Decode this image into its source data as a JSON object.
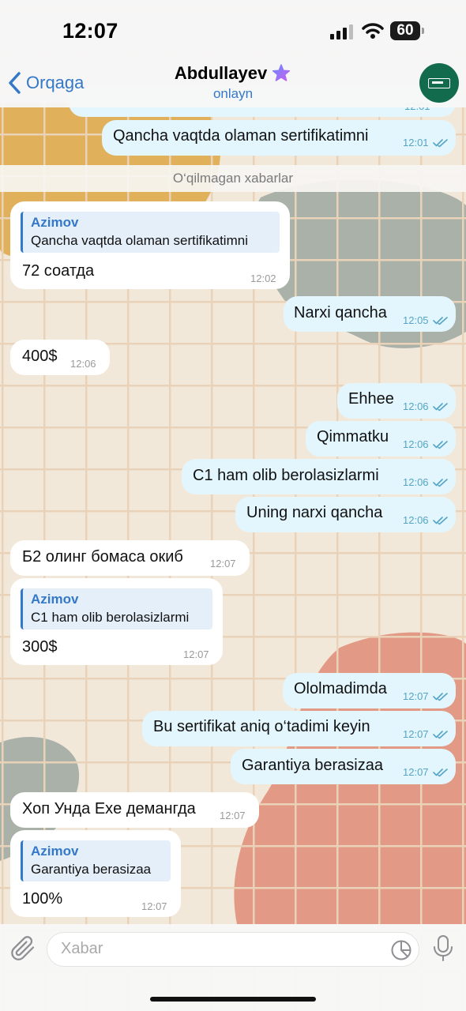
{
  "status_bar": {
    "time": "12:07",
    "battery": "60"
  },
  "header": {
    "back_label": "Orqaga",
    "contact_name": "Abdullayev",
    "contact_status": "onlayn"
  },
  "unread_divider": "O‘qilmagan xabarlar",
  "messages": [
    {
      "dir": "out",
      "text": "Qancha vaqtda olaman sertifikatimni",
      "time": "12:01",
      "read": true
    },
    {
      "dir": "in",
      "reply_name": "Azimov",
      "reply_text": "Qancha vaqtda olaman sertifikatimni",
      "text": "72 соатда",
      "time": "12:02"
    },
    {
      "dir": "out",
      "text": "Narxi qancha",
      "time": "12:05",
      "read": true
    },
    {
      "dir": "in",
      "text": "400$",
      "time": "12:06"
    },
    {
      "dir": "out",
      "text": "Ehhee",
      "time": "12:06",
      "read": true
    },
    {
      "dir": "out",
      "text": "Qimmatku",
      "time": "12:06",
      "read": true
    },
    {
      "dir": "out",
      "text": "C1 ham olib berolasizlarmi",
      "time": "12:06",
      "read": true
    },
    {
      "dir": "out",
      "text": "Uning narxi qancha",
      "time": "12:06",
      "read": true
    },
    {
      "dir": "in",
      "text": "Б2 олинг бомаса окиб",
      "time": "12:07"
    },
    {
      "dir": "in",
      "reply_name": "Azimov",
      "reply_text": "C1 ham olib berolasizlarmi",
      "text": "300$",
      "time": "12:07"
    },
    {
      "dir": "out",
      "text": "Ololmadimda",
      "time": "12:07",
      "read": true
    },
    {
      "dir": "out",
      "text": "Bu sertifikat aniq o‘tadimi keyin",
      "time": "12:07",
      "read": true
    },
    {
      "dir": "out",
      "text": "Garantiya berasizaa",
      "time": "12:07",
      "read": true
    },
    {
      "dir": "in",
      "text": "Хоп Унда Exe демангда",
      "time": "12:07"
    },
    {
      "dir": "in",
      "reply_name": "Azimov",
      "reply_text": "Garantiya berasizaa",
      "text": "100%",
      "time": "12:07"
    }
  ],
  "composer": {
    "placeholder": "Xabar"
  },
  "icons": {
    "back": "chevron-left-icon",
    "premium": "star-icon",
    "attach": "paperclip-icon",
    "sticker": "sticker-icon",
    "voice": "microphone-icon",
    "read": "double-check-icon"
  },
  "colors": {
    "accent": "#3478c8",
    "outgoing_bubble": "#e3f6fd",
    "incoming_bubble": "#ffffff",
    "avatar": "#136b4e"
  }
}
